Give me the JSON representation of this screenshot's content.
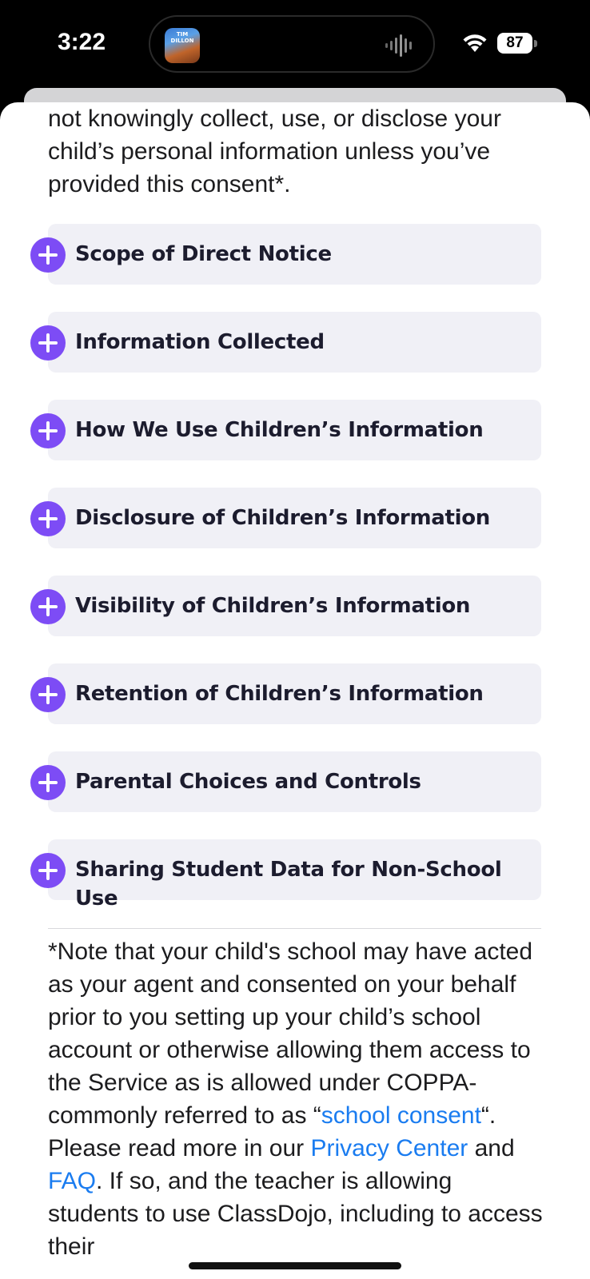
{
  "status_bar": {
    "time": "3:22",
    "battery": "87",
    "island_thumb_text": "TIM DILLON"
  },
  "intro_text": "not knowingly collect, use, or disclose your child’s personal information unless you’ve provided this consent*.",
  "accordion": [
    {
      "label": "Scope of Direct Notice"
    },
    {
      "label": "Information Collected"
    },
    {
      "label": "How We Use Children’s Information"
    },
    {
      "label": "Disclosure of Children’s Information"
    },
    {
      "label": "Visibility of Children’s Information"
    },
    {
      "label": "Retention of Children’s Information"
    },
    {
      "label": "Parental Choices and Controls"
    },
    {
      "label": "Sharing Student Data for Non-School Use"
    }
  ],
  "note": {
    "part1": "*Note that your child's school may have acted as your agent and consented on your behalf prior to you setting up your child’s school account or otherwise allowing them access to the Service as is allowed under COPPA- commonly referred to as “",
    "link_school_consent": "school consent",
    "part2": "“. Please read more in our ",
    "link_privacy_center": "Privacy Center",
    "part3": " and ",
    "link_faq": "FAQ",
    "part4": ". If so, and the teacher is allowing students to use ClassDojo, including to access their"
  },
  "colors": {
    "accent_purple": "#7d4cf5",
    "link_blue": "#1a7cf0",
    "accordion_bg": "#f0f0f6"
  },
  "icons": [
    "wifi-icon",
    "battery-icon",
    "waveform-icon",
    "plus-icon"
  ]
}
